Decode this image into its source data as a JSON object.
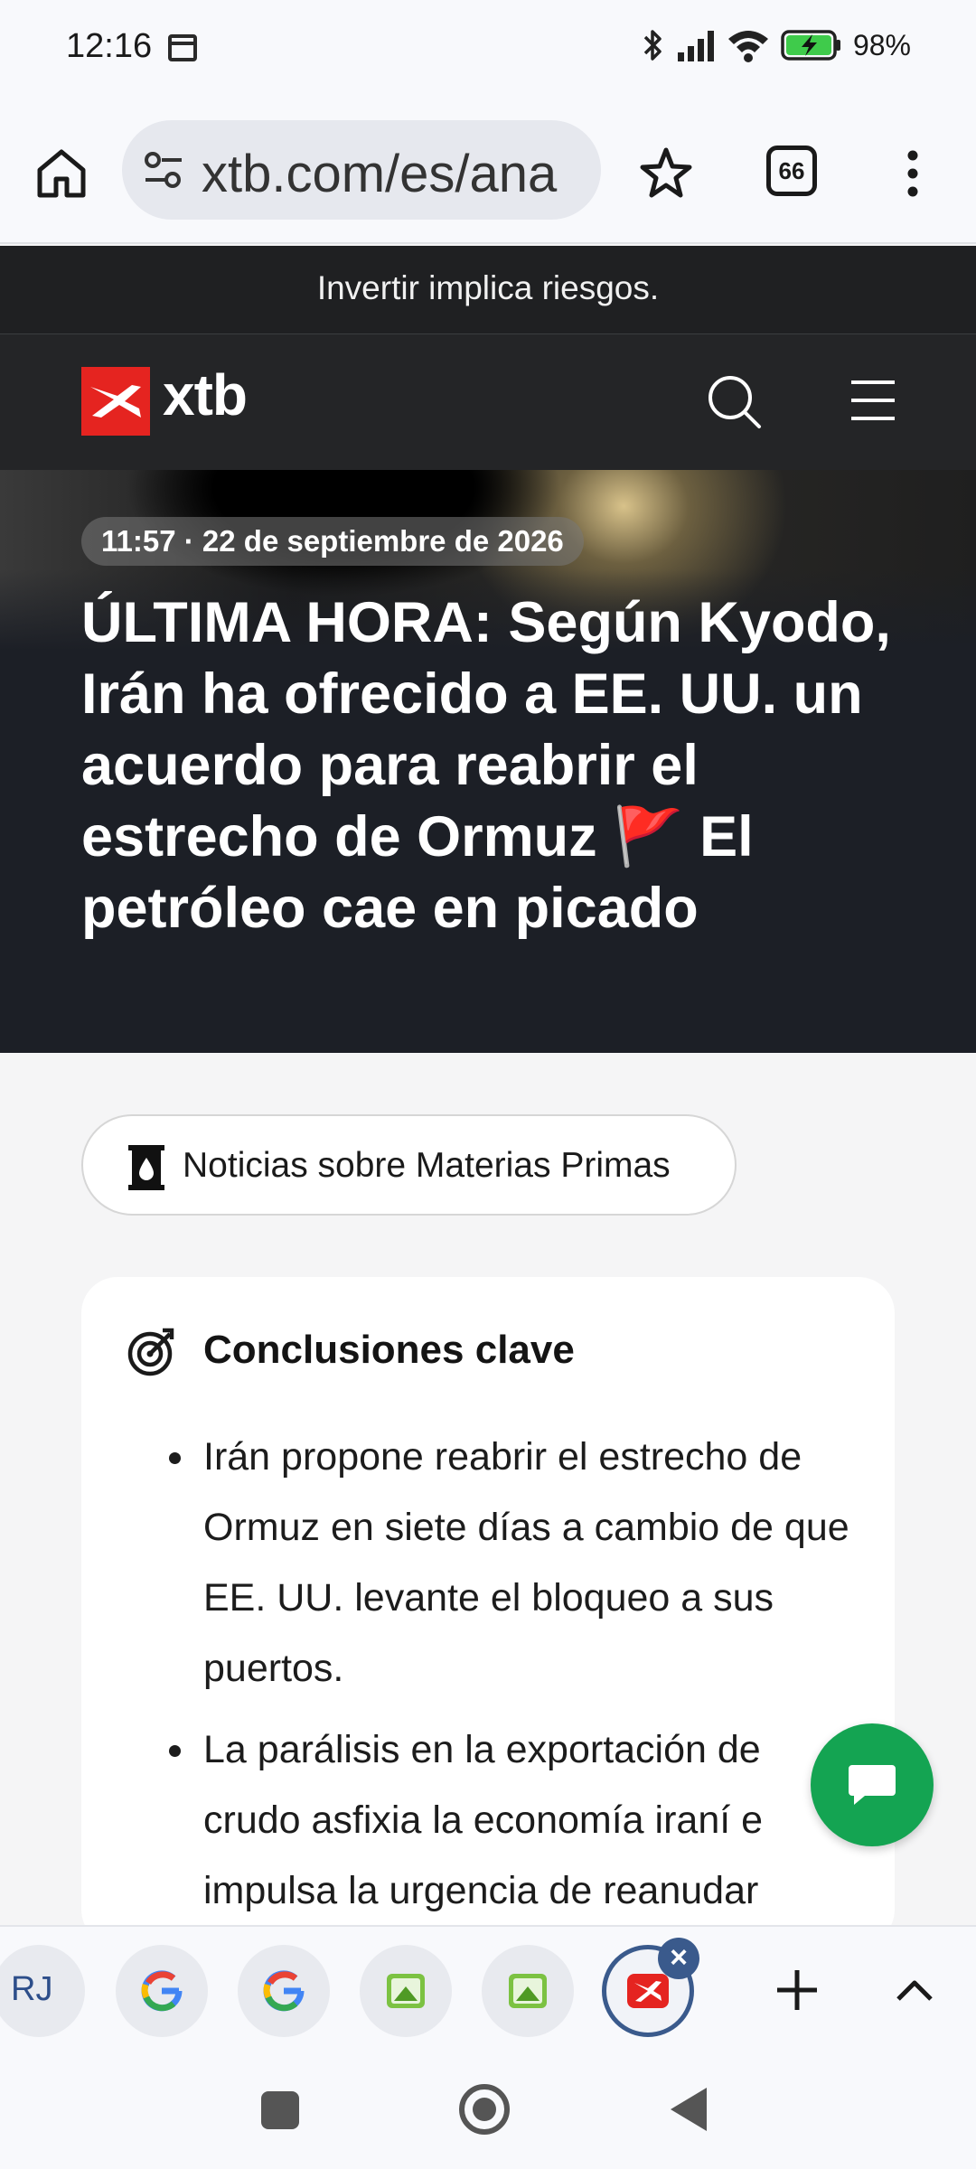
{
  "status_bar": {
    "time": "12:16",
    "battery": "98%",
    "icons": [
      "calendar-icon",
      "bluetooth-icon",
      "signal-icon",
      "wifi-icon",
      "battery-charging-icon"
    ]
  },
  "browser": {
    "url": "xtb.com/es/ana",
    "tab_count": "66",
    "icons": [
      "home-icon",
      "tune-icon",
      "star-icon",
      "tabs-icon",
      "more-vert-icon"
    ]
  },
  "risk_banner": {
    "text": "Invertir implica riesgos."
  },
  "site_nav": {
    "brand": "xtb",
    "brand_color": "#e52420",
    "icons": [
      "search-icon",
      "hamburger-menu-icon"
    ]
  },
  "article": {
    "date": "11:57 · 22 de septiembre de 2026",
    "title": "ÚLTIMA HORA: Según Kyodo, Irán ha ofrecido a EE. UU. un acuerdo para reabrir el estrecho de Ormuz 🚩 El petróleo cae en picado",
    "category": "Noticias sobre Materias Primas",
    "key_takeaways": {
      "title": "Conclusiones clave",
      "items": [
        "Irán propone reabrir el estrecho de Ormuz en siete días a cambio de que EE. UU. levante el bloqueo a sus puertos.",
        "La parálisis en la exportación de crudo asfixia la economía iraní e impulsa la urgencia de reanudar"
      ]
    }
  },
  "chat": {
    "color": "#14a452",
    "icon": "chat-bubble-icon"
  },
  "tab_strip": {
    "tabs": [
      {
        "label": "RJ",
        "icon": "rj-favicon"
      },
      {
        "label": "",
        "icon": "google-favicon"
      },
      {
        "label": "",
        "icon": "google-favicon"
      },
      {
        "label": "",
        "icon": "green-image-favicon"
      },
      {
        "label": "",
        "icon": "green-image-favicon"
      },
      {
        "label": "",
        "icon": "xtb-favicon",
        "active": true
      }
    ],
    "active_color": "#3a5a8c"
  },
  "system_nav": {
    "icons": [
      "recents-icon",
      "home-icon",
      "back-icon"
    ]
  }
}
